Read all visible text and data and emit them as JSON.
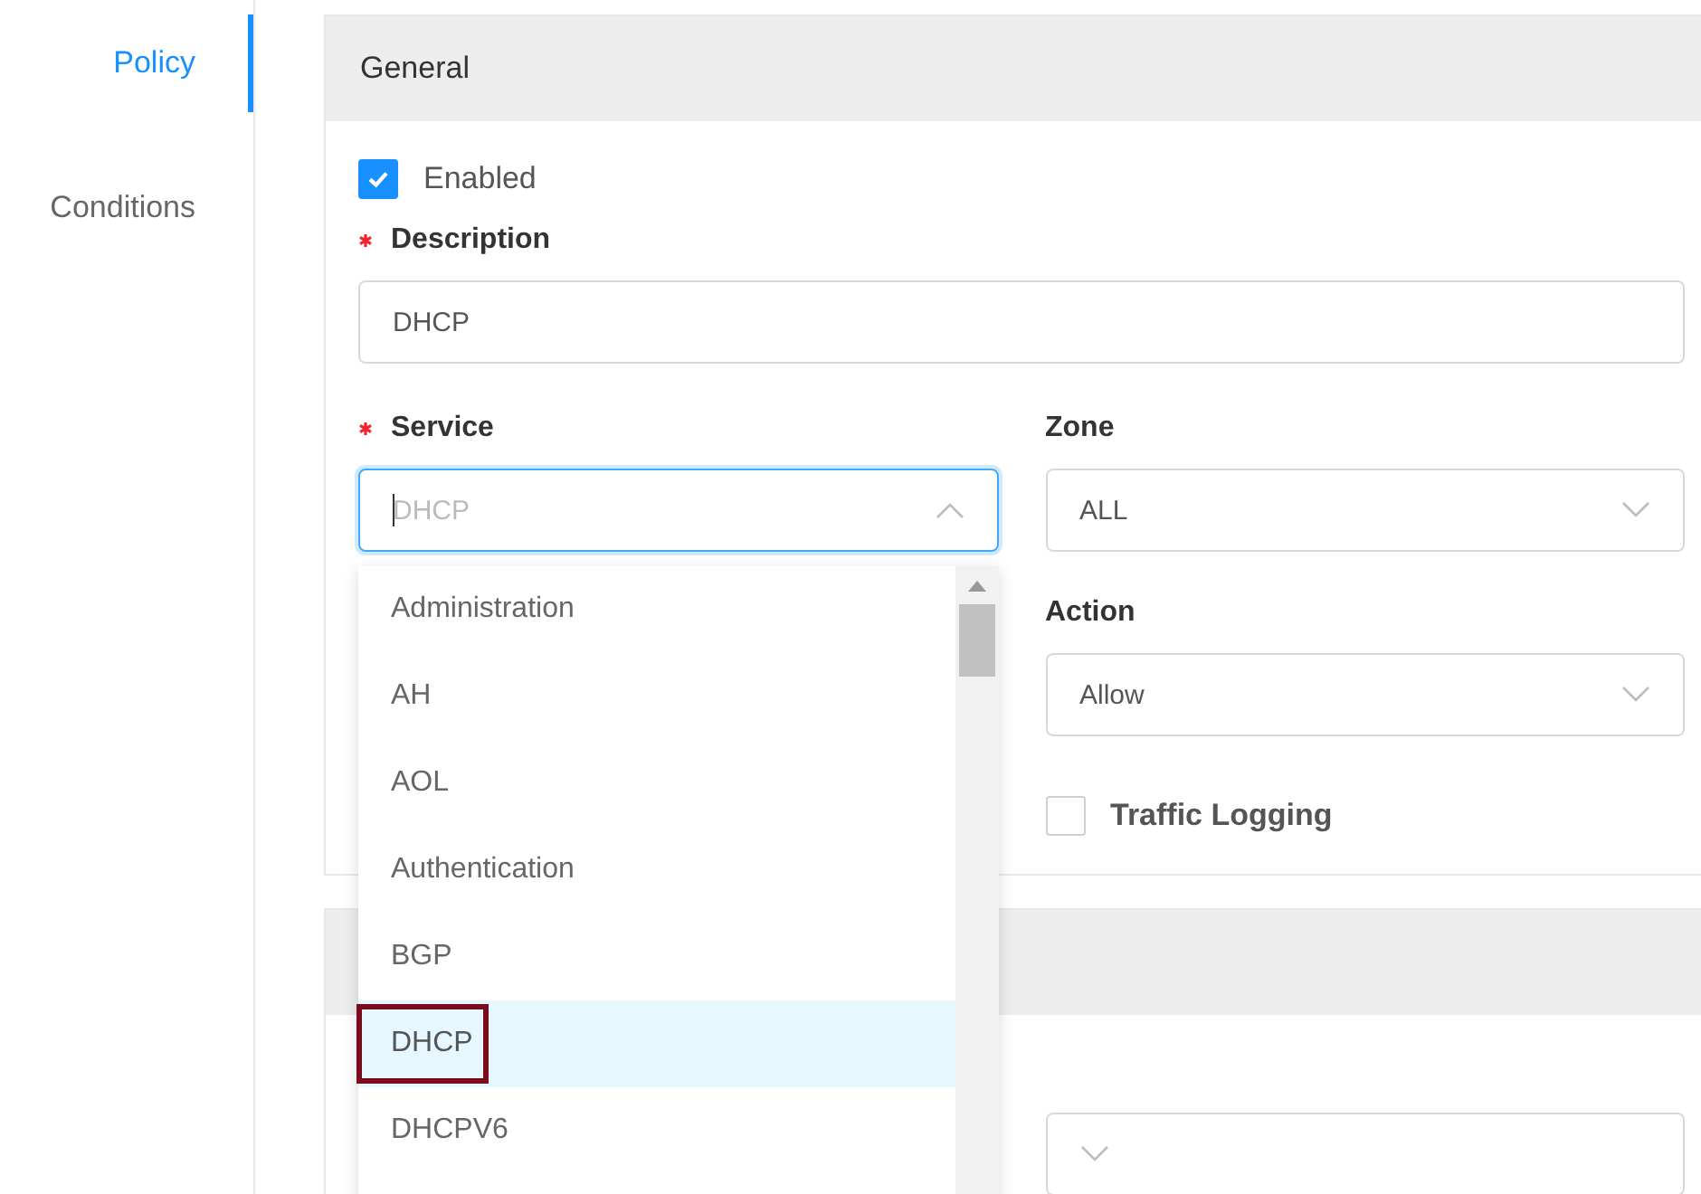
{
  "nav": {
    "items": [
      {
        "label": "Policy",
        "selected": true
      },
      {
        "label": "Conditions",
        "selected": false
      }
    ]
  },
  "general": {
    "title": "General",
    "enabled": {
      "label": "Enabled",
      "checked": true
    },
    "description": {
      "label": "Description",
      "required": true,
      "value": "DHCP"
    },
    "service": {
      "label": "Service",
      "required": true,
      "placeholder": "DHCP",
      "expanded": true,
      "options": [
        {
          "label": "Administration",
          "selected": false,
          "annotated": false
        },
        {
          "label": "AH",
          "selected": false,
          "annotated": false
        },
        {
          "label": "AOL",
          "selected": false,
          "annotated": false
        },
        {
          "label": "Authentication",
          "selected": false,
          "annotated": false
        },
        {
          "label": "BGP",
          "selected": false,
          "annotated": false
        },
        {
          "label": "DHCP",
          "selected": true,
          "annotated": true
        },
        {
          "label": "DHCPV6",
          "selected": false,
          "annotated": false
        }
      ]
    },
    "zone": {
      "label": "Zone",
      "required": false,
      "value": "ALL"
    },
    "action": {
      "label": "Action",
      "required": false,
      "value": "Allow"
    },
    "traffic_logging": {
      "label": "Traffic Logging",
      "checked": false
    }
  }
}
